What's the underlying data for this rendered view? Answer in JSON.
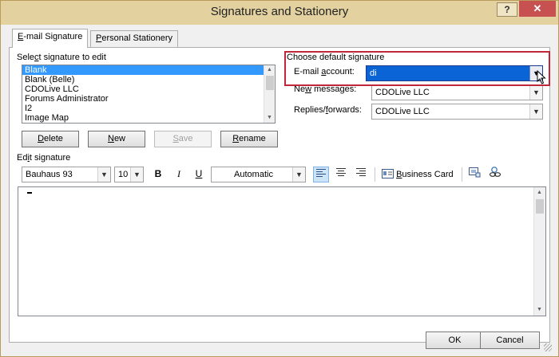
{
  "window": {
    "title": "Signatures and Stationery",
    "help_label": "?",
    "close_label": "✕"
  },
  "tabs": [
    {
      "label": "E-mail Signature",
      "hotkey": "E",
      "rest": "-mail Signature",
      "active": true
    },
    {
      "label": "Personal Stationery",
      "hotkey": "P",
      "rest": "ersonal Stationery",
      "active": false
    }
  ],
  "select_section": {
    "label_pre": "Sele",
    "label_hot": "c",
    "label_post": "t signature to edit",
    "items": [
      "Blank",
      "Blank (Belle)",
      "CDOLive LLC",
      "Forums Administrator",
      "I2",
      "Image Map"
    ],
    "selected_index": 0
  },
  "list_buttons": {
    "delete": {
      "hot": "D",
      "rest": "elete"
    },
    "new": {
      "hot": "N",
      "rest": "ew"
    },
    "save": {
      "hot": "S",
      "rest": "ave"
    },
    "rename": {
      "hot": "R",
      "rest": "ename"
    }
  },
  "default_section": {
    "title": "Choose default signature",
    "email_label_pre": "E-mail ",
    "email_label_hot": "a",
    "email_label_post": "ccount:",
    "email_value": "di",
    "new_label_pre": "Ne",
    "new_label_hot": "w",
    "new_label_post": " messages:",
    "new_value": "CDOLive LLC",
    "replies_label_pre": "Replies/",
    "replies_label_hot": "f",
    "replies_label_post": "orwards:",
    "replies_value": "CDOLive LLC"
  },
  "edit_section": {
    "label_pre": "Ed",
    "label_hot": "i",
    "label_post": "t signature",
    "font_name": "Bauhaus 93",
    "font_size": "10",
    "bold": "B",
    "italic": "I",
    "underline": "U",
    "color": "Automatic",
    "business_card_hot": "B",
    "business_card_rest": "usiness Card"
  },
  "footer": {
    "ok": "OK",
    "cancel": "Cancel"
  },
  "colors": {
    "accent_red": "#c0283a",
    "selection_blue": "#3399ff",
    "title_bar": "#e3d2a0"
  }
}
